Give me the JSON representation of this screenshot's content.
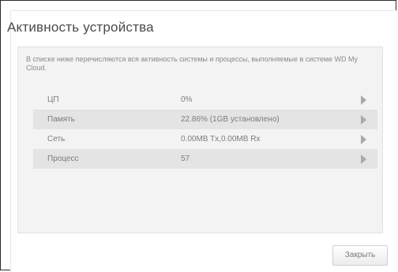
{
  "dialog": {
    "title": "Активность устройства",
    "description": "В списке ниже перечисляются вся активность системы и процессы, выполняемые в системе WD My Cloud."
  },
  "rows": [
    {
      "label": "ЦП",
      "value": "0%",
      "arrow_icon": "chevron-right-icon"
    },
    {
      "label": "Память",
      "value": "22.86% (1GB установлено)",
      "arrow_icon": "chevron-right-icon"
    },
    {
      "label": "Сеть",
      "value": "0.00MB Tx,0.00MB Rx",
      "arrow_icon": "chevron-right-icon"
    },
    {
      "label": "Процесс",
      "value": "57",
      "arrow_icon": "chevron-right-icon"
    }
  ],
  "buttons": {
    "close_label": "Закрыть"
  },
  "colors": {
    "row_light": "#f3f3f3",
    "row_dark": "#e4e4e4",
    "text": "#7b7b7b",
    "border": "#2b2b2b"
  }
}
